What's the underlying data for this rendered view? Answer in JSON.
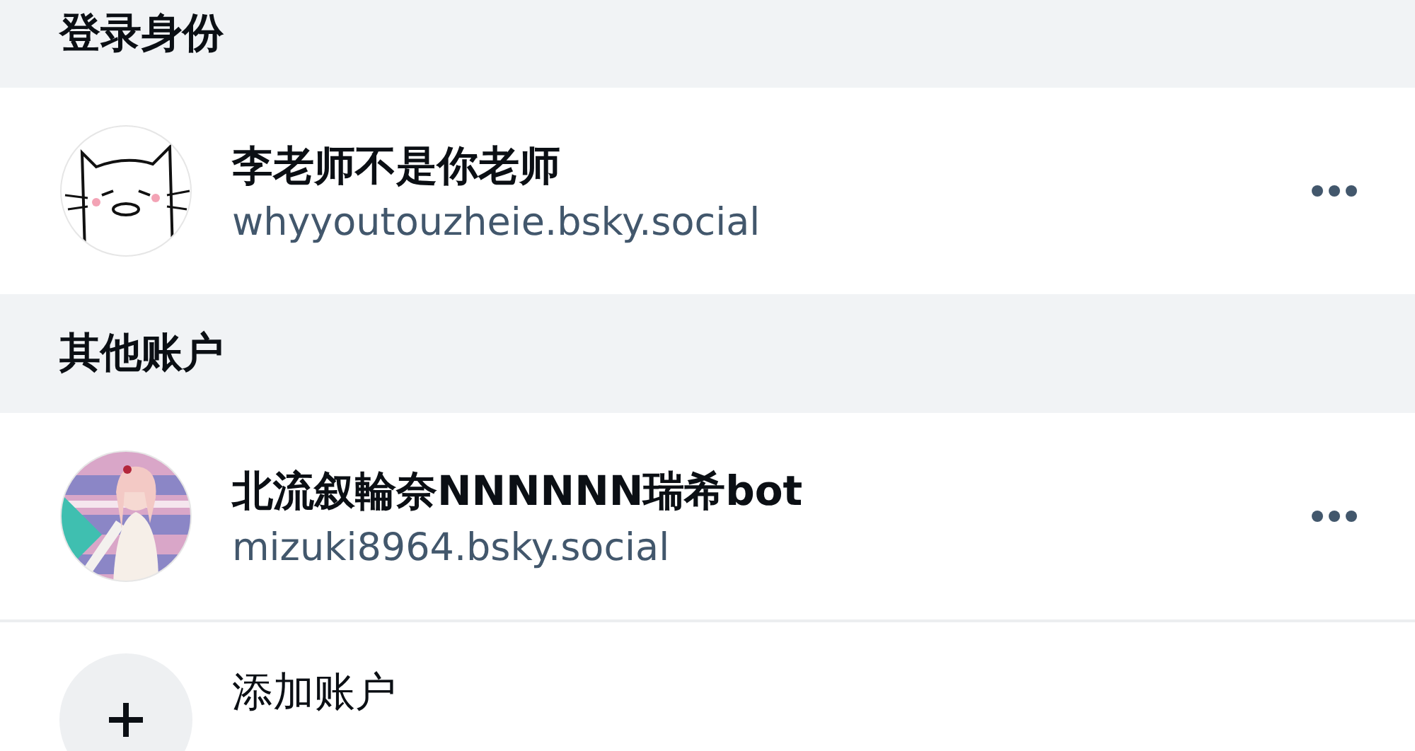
{
  "sections": [
    {
      "title": "登录身份",
      "accounts": [
        {
          "name": "李老师不是你老师",
          "handle": "whyyoutouzheie.bsky.social"
        }
      ]
    },
    {
      "title": "其他账户",
      "accounts": [
        {
          "name": "北流叙輪奈NNNNNN瑞希bot",
          "handle": "mizuki8964.bsky.social"
        }
      ]
    }
  ],
  "add_account": {
    "label": "添加账户"
  }
}
